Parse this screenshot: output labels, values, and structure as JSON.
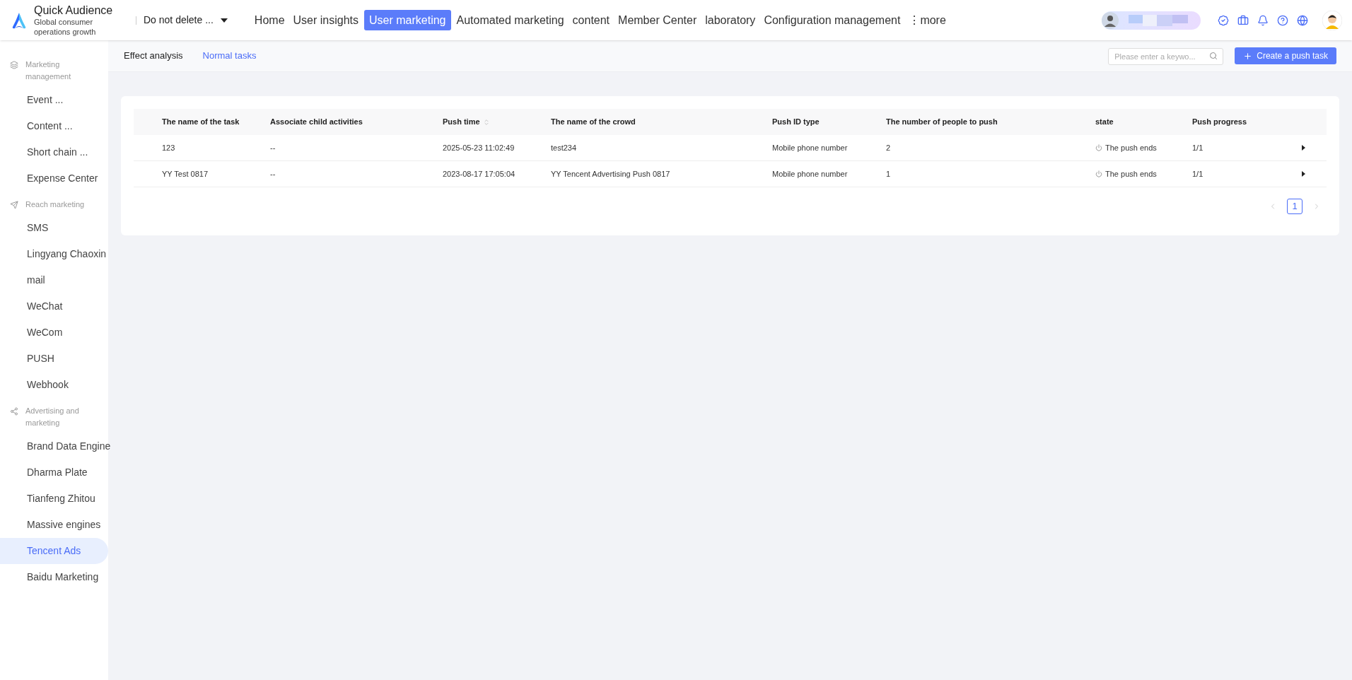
{
  "brand": {
    "name": "Quick Audience",
    "tagline": "Global consumer operations growth"
  },
  "workspace": {
    "label": "Do not delete ..."
  },
  "nav": [
    {
      "label": "Home",
      "selected": false
    },
    {
      "label": "User insights",
      "selected": false
    },
    {
      "label": "User marketing",
      "selected": true
    },
    {
      "label": "Automated marketing",
      "selected": false
    },
    {
      "label": "content",
      "selected": false
    },
    {
      "label": "Member Center",
      "selected": false
    },
    {
      "label": "laboratory",
      "selected": false
    },
    {
      "label": "Configuration management",
      "selected": false
    },
    {
      "label": "⋮more",
      "selected": false
    }
  ],
  "sidebar": {
    "groups": [
      {
        "label": "Marketing management",
        "kind": "layers",
        "items": [
          {
            "label": "Event ...",
            "selected": false
          },
          {
            "label": "Content ...",
            "selected": false
          },
          {
            "label": "Short chain ...",
            "selected": false
          },
          {
            "label": "Expense Center",
            "selected": false
          }
        ]
      },
      {
        "label": "Reach marketing",
        "kind": "send",
        "items": [
          {
            "label": "SMS",
            "selected": false
          },
          {
            "label": "Lingyang Chaoxin",
            "selected": false
          },
          {
            "label": "mail",
            "selected": false
          },
          {
            "label": "WeChat",
            "selected": false
          },
          {
            "label": "WeCom",
            "selected": false
          },
          {
            "label": "PUSH",
            "selected": false
          },
          {
            "label": "Webhook",
            "selected": false
          }
        ]
      },
      {
        "label": "Advertising and marketing",
        "kind": "network",
        "items": [
          {
            "label": "Brand Data Engine",
            "selected": false
          },
          {
            "label": "Dharma Plate",
            "selected": false
          },
          {
            "label": "Tianfeng Zhitou",
            "selected": false
          },
          {
            "label": "Massive engines",
            "selected": false
          },
          {
            "label": "Tencent Ads",
            "selected": true
          },
          {
            "label": "Baidu Marketing",
            "selected": false
          }
        ]
      }
    ]
  },
  "tabs": [
    {
      "label": "Effect analysis",
      "selected": false
    },
    {
      "label": "Normal tasks",
      "selected": true
    }
  ],
  "search": {
    "placeholder": "Please enter a keywo..."
  },
  "create_button": {
    "label": "Create a push task"
  },
  "table": {
    "columns": [
      {
        "label": "The name of the task"
      },
      {
        "label": "Associate child activities"
      },
      {
        "label": "Push time",
        "sortable": true
      },
      {
        "label": "The name of the crowd"
      },
      {
        "label": "Push ID type"
      },
      {
        "label": "The number of people to push"
      },
      {
        "label": "state"
      },
      {
        "label": "Push progress"
      }
    ],
    "rows": [
      {
        "cells": [
          "123",
          "--",
          "2025-05-23 11:02:49",
          "test234",
          "Mobile phone number",
          "2"
        ],
        "state": "The push ends",
        "progress": "1/1"
      },
      {
        "cells": [
          "YY Test 0817",
          "--",
          "2023-08-17 17:05:04",
          "YY Tencent Advertising Push 0817",
          "Mobile phone number",
          "1"
        ],
        "state": "The push ends",
        "progress": "1/1"
      }
    ]
  },
  "pagination": {
    "pages": [
      {
        "label": "1",
        "selected": true
      }
    ]
  }
}
